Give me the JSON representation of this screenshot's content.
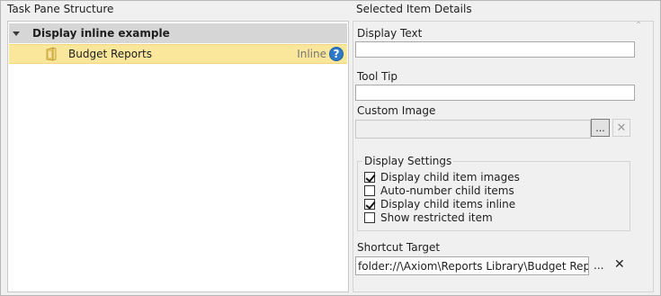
{
  "left_panel": {
    "title": "Task Pane Structure",
    "group": {
      "label": "Display inline example",
      "expanded": true
    },
    "items": [
      {
        "label": "Budget Reports",
        "badge": "Inline",
        "icon": "folder-icon",
        "selected": true
      }
    ]
  },
  "right_panel": {
    "title": "Selected Item Details",
    "display_text": {
      "label": "Display Text",
      "value": ""
    },
    "tool_tip": {
      "label": "Tool Tip",
      "value": ""
    },
    "custom_image": {
      "label": "Custom Image",
      "value": "",
      "browse_label": "...",
      "clear_icon": "close-icon"
    },
    "display_settings": {
      "title": "Display Settings",
      "options": [
        {
          "label": "Display child item images",
          "checked": true
        },
        {
          "label": "Auto-number child items",
          "checked": false
        },
        {
          "label": "Display child items inline",
          "checked": true
        },
        {
          "label": "Show restricted item",
          "checked": false
        }
      ]
    },
    "shortcut_target": {
      "label": "Shortcut Target",
      "value": "folder://\\Axiom\\Reports Library\\Budget Reports",
      "browse_label": "...",
      "clear_icon": "close-icon"
    }
  },
  "colors": {
    "selected_row": "#fbe79b",
    "group_row": "#d6d6d6",
    "help_icon": "#2d79c7"
  }
}
